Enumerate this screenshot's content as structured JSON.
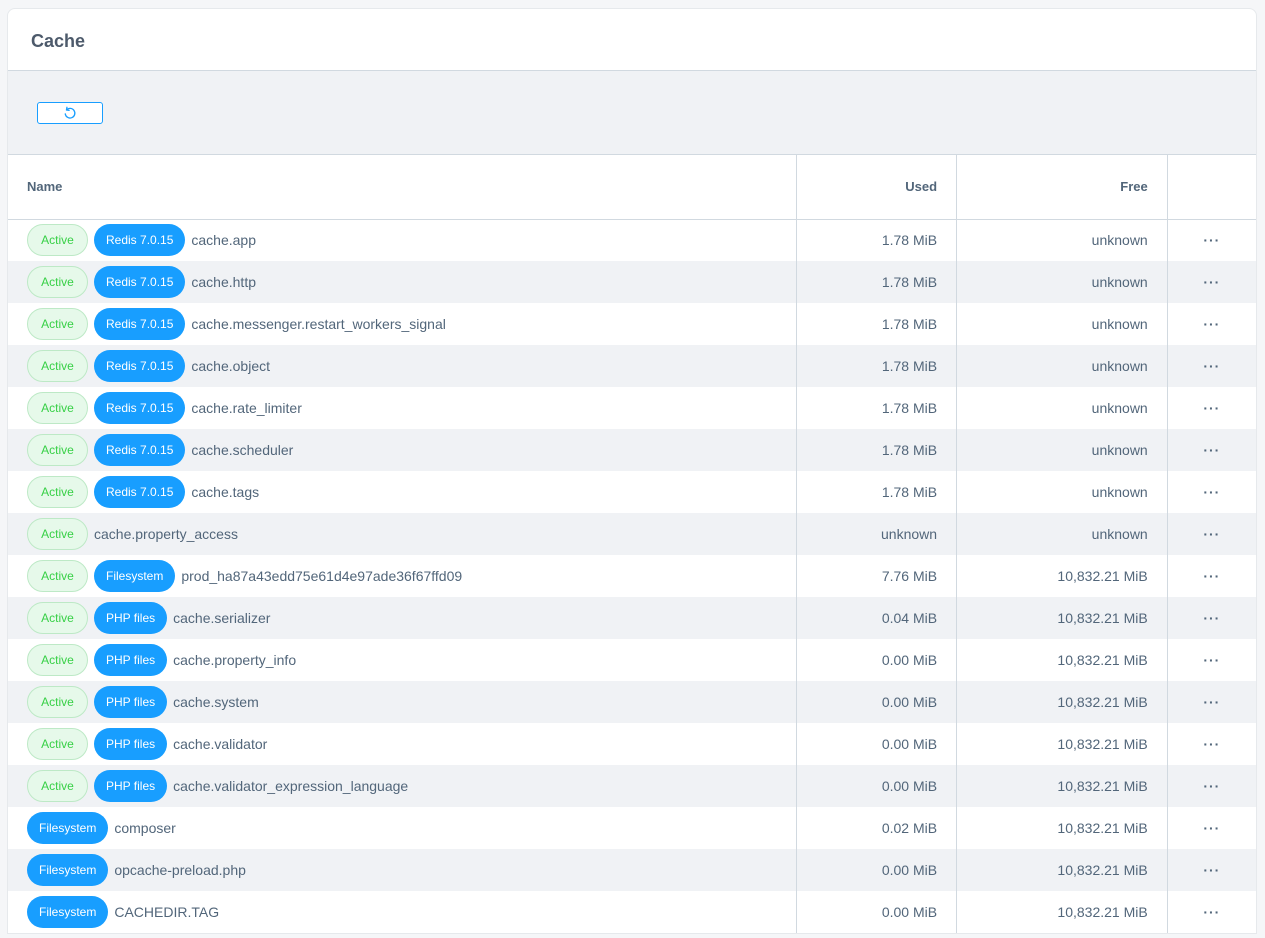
{
  "title": "Cache",
  "toolbar": {
    "refresh_icon": "refresh-icon"
  },
  "colors": {
    "accent": "#189eff",
    "active_text": "#37d046",
    "active_bg": "#e6f9ea"
  },
  "columns": {
    "name": "Name",
    "used": "Used",
    "free": "Free"
  },
  "rows": [
    {
      "status": "Active",
      "type": "Redis 7.0.15",
      "name": "cache.app",
      "used": "1.78 MiB",
      "free": "unknown"
    },
    {
      "status": "Active",
      "type": "Redis 7.0.15",
      "name": "cache.http",
      "used": "1.78 MiB",
      "free": "unknown"
    },
    {
      "status": "Active",
      "type": "Redis 7.0.15",
      "name": "cache.messenger.restart_workers_signal",
      "used": "1.78 MiB",
      "free": "unknown"
    },
    {
      "status": "Active",
      "type": "Redis 7.0.15",
      "name": "cache.object",
      "used": "1.78 MiB",
      "free": "unknown"
    },
    {
      "status": "Active",
      "type": "Redis 7.0.15",
      "name": "cache.rate_limiter",
      "used": "1.78 MiB",
      "free": "unknown"
    },
    {
      "status": "Active",
      "type": "Redis 7.0.15",
      "name": "cache.scheduler",
      "used": "1.78 MiB",
      "free": "unknown"
    },
    {
      "status": "Active",
      "type": "Redis 7.0.15",
      "name": "cache.tags",
      "used": "1.78 MiB",
      "free": "unknown"
    },
    {
      "status": "Active",
      "type": null,
      "name": "cache.property_access",
      "used": "unknown",
      "free": "unknown"
    },
    {
      "status": "Active",
      "type": "Filesystem",
      "name": "prod_ha87a43edd75e61d4e97ade36f67ffd09",
      "used": "7.76 MiB",
      "free": "10,832.21 MiB"
    },
    {
      "status": "Active",
      "type": "PHP files",
      "name": "cache.serializer",
      "used": "0.04 MiB",
      "free": "10,832.21 MiB"
    },
    {
      "status": "Active",
      "type": "PHP files",
      "name": "cache.property_info",
      "used": "0.00 MiB",
      "free": "10,832.21 MiB"
    },
    {
      "status": "Active",
      "type": "PHP files",
      "name": "cache.system",
      "used": "0.00 MiB",
      "free": "10,832.21 MiB"
    },
    {
      "status": "Active",
      "type": "PHP files",
      "name": "cache.validator",
      "used": "0.00 MiB",
      "free": "10,832.21 MiB"
    },
    {
      "status": "Active",
      "type": "PHP files",
      "name": "cache.validator_expression_language",
      "used": "0.00 MiB",
      "free": "10,832.21 MiB"
    },
    {
      "status": null,
      "type": "Filesystem",
      "name": "composer",
      "used": "0.02 MiB",
      "free": "10,832.21 MiB"
    },
    {
      "status": null,
      "type": "Filesystem",
      "name": "opcache-preload.php",
      "used": "0.00 MiB",
      "free": "10,832.21 MiB"
    },
    {
      "status": null,
      "type": "Filesystem",
      "name": "CACHEDIR.TAG",
      "used": "0.00 MiB",
      "free": "10,832.21 MiB"
    }
  ],
  "actions_label": "···"
}
